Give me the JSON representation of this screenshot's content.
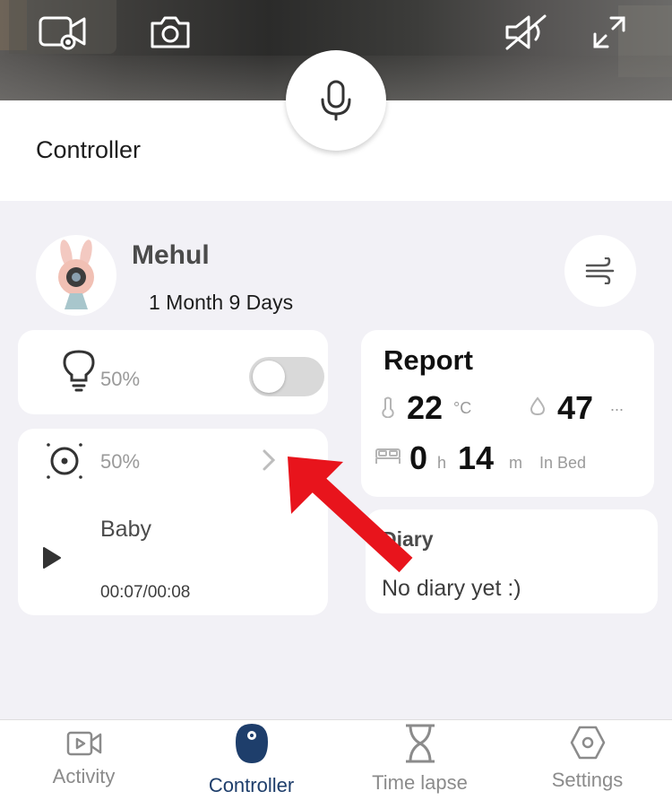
{
  "camera": {
    "record_icon": "video-record-icon",
    "snapshot_icon": "camera-icon",
    "mute_icon": "speaker-muted-icon",
    "fullscreen_icon": "expand-icon"
  },
  "header": {
    "title": "Controller",
    "mic_icon": "microphone-icon"
  },
  "profile": {
    "name": "Mehul",
    "age": "1 Month 9 Days",
    "wind_icon": "wind-icon"
  },
  "light": {
    "percent": "50%",
    "toggle_on": false
  },
  "music": {
    "percent": "50%",
    "song": "Baby",
    "time": "00:07/00:08"
  },
  "report": {
    "title": "Report",
    "temperature": "22",
    "temperature_unit": "°C",
    "humidity": "47",
    "humidity_more": "...",
    "sleep_hours": "0",
    "hours_unit": "h",
    "sleep_minutes": "14",
    "minutes_unit": "m",
    "sleep_label": "In Bed"
  },
  "diary": {
    "title": "Diary",
    "text": "No diary yet :)"
  },
  "tabs": [
    {
      "label": "Activity",
      "icon": "video-icon"
    },
    {
      "label": "Controller",
      "icon": "controller-icon"
    },
    {
      "label": "Time lapse",
      "icon": "hourglass-icon"
    },
    {
      "label": "Settings",
      "icon": "hexagon-gear-icon"
    }
  ],
  "colors": {
    "accent": "#1e3e6b",
    "arrow": "#e8141c",
    "background": "#f2f1f6"
  }
}
